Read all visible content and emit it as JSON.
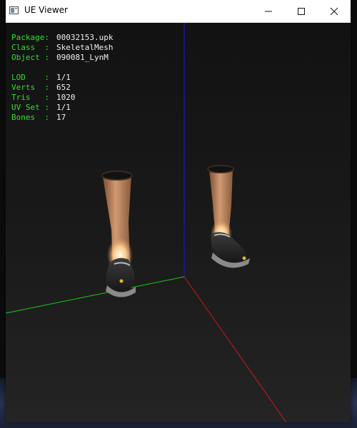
{
  "window": {
    "title": "UE Viewer",
    "icon": "app-window-icon"
  },
  "controls": {
    "minimize": "minimize-icon",
    "maximize": "maximize-icon",
    "close": "close-icon"
  },
  "info": {
    "package_label": "Package:",
    "package_value": "00032153.upk",
    "class_label": "Class  :",
    "class_value": "SkeletalMesh",
    "object_label": "Object :",
    "object_value": "090081_LynM",
    "lod_label": "LOD    :",
    "lod_value": "1/1",
    "verts_label": "Verts  :",
    "verts_value": "652",
    "tris_label": "Tris   :",
    "tris_value": "1020",
    "uvset_label": "UV Set :",
    "uvset_value": "1/1",
    "bones_label": "Bones  :",
    "bones_value": "17"
  },
  "colors": {
    "info_label": "#2fe02f",
    "info_value": "#f0f0f0",
    "axis_x": "#cc1818",
    "axis_y": "#18cc18",
    "axis_z": "#1a1ad0",
    "viewport_bg": "#1a1a1a"
  }
}
